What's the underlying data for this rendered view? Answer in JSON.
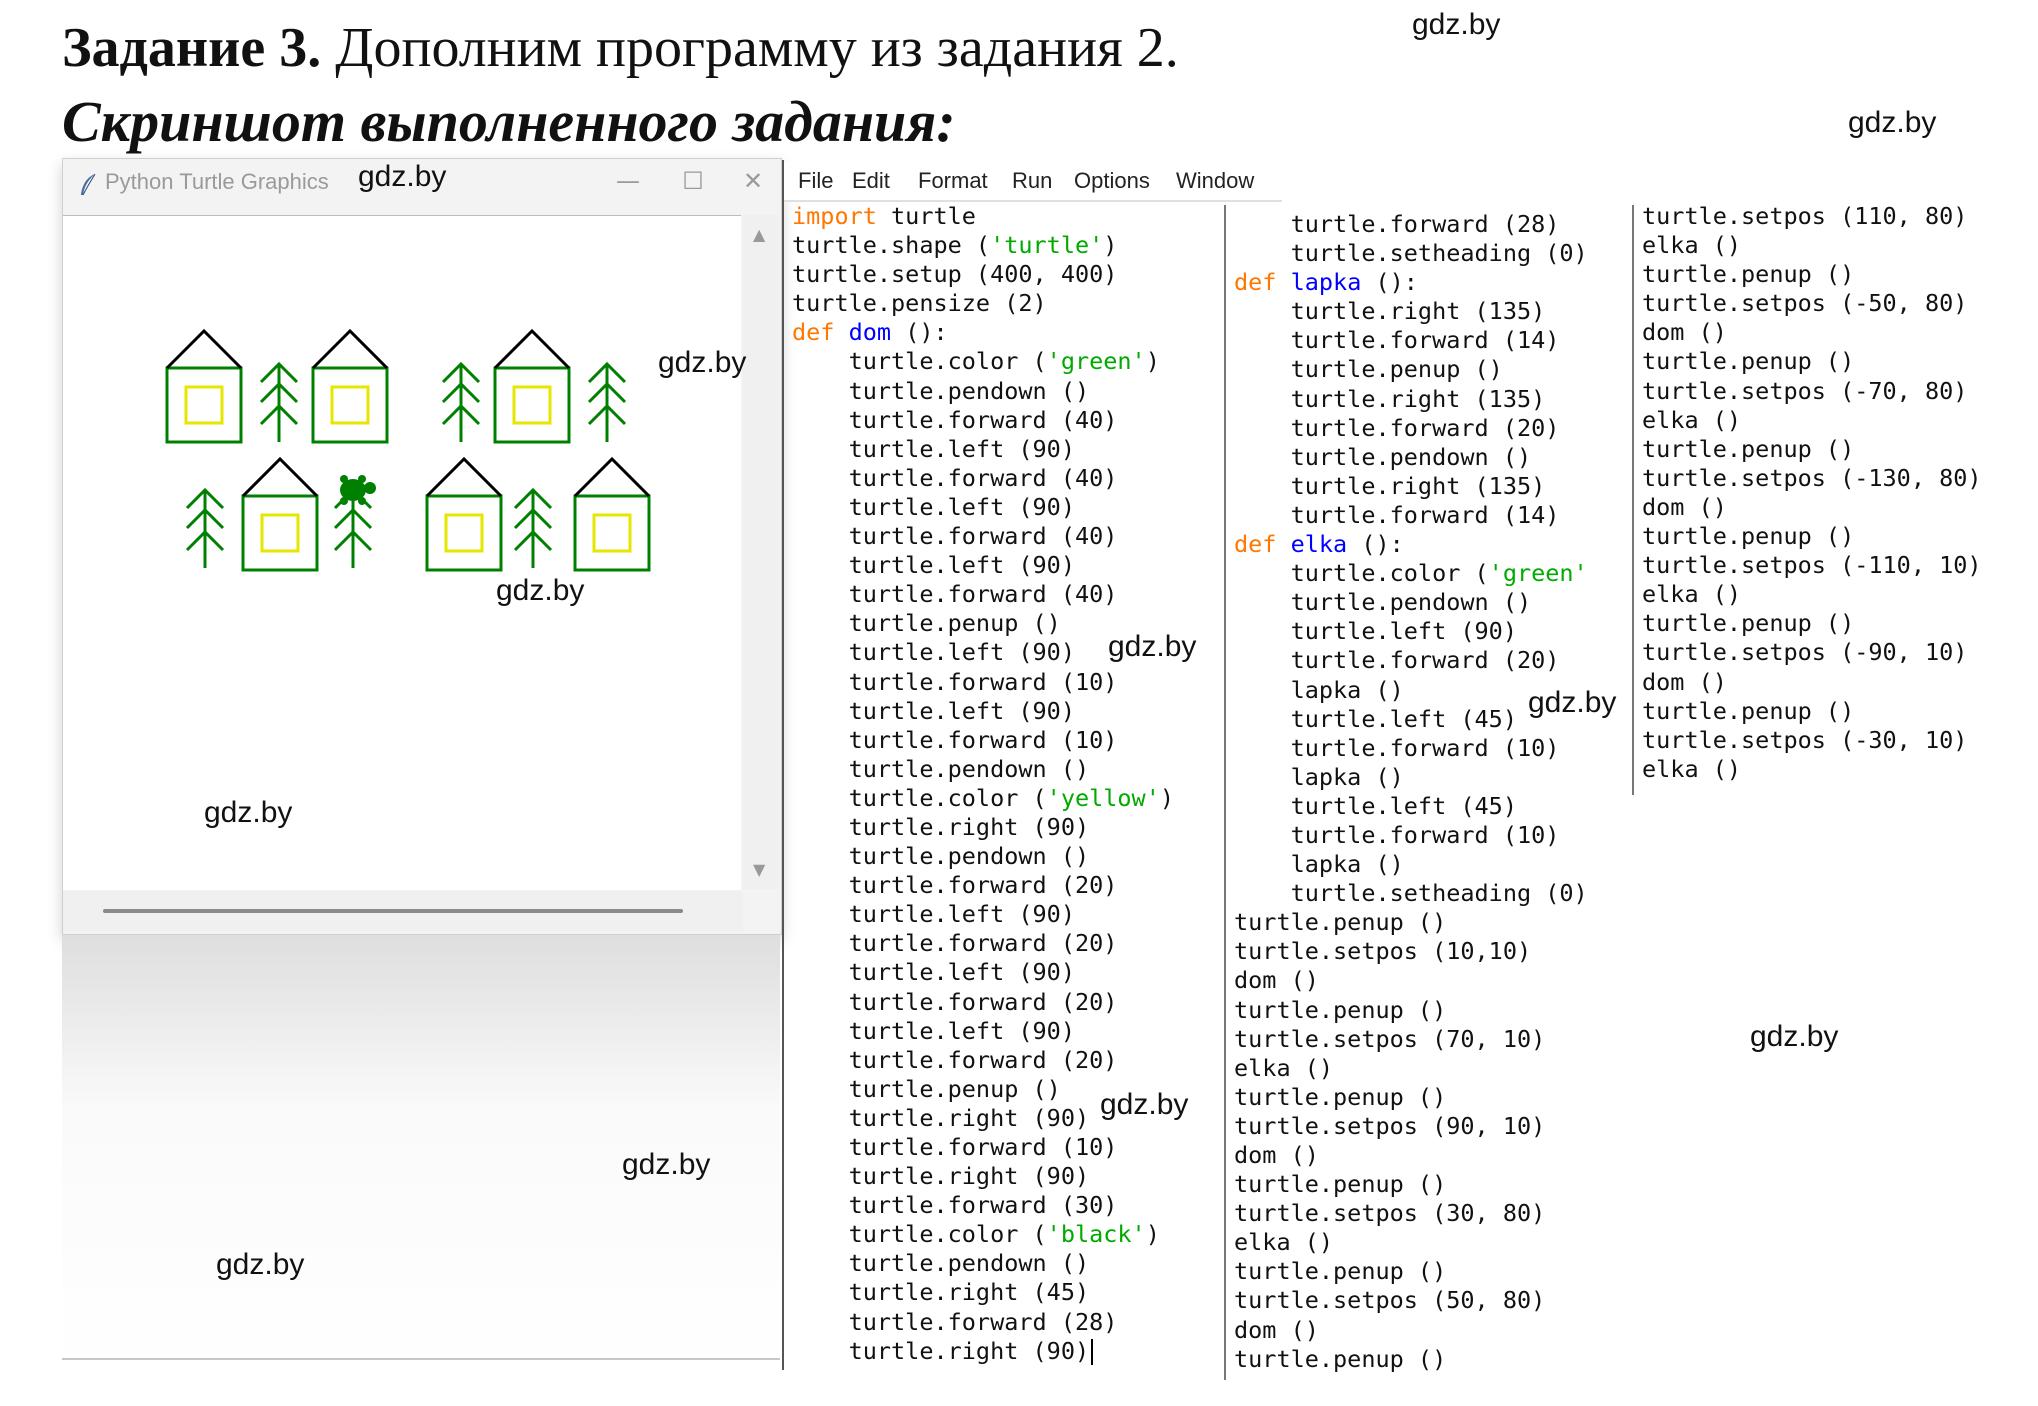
{
  "header": {
    "task_bold": "Задание 3.",
    "task_rest": " Дополним программу из задания 2.",
    "subtitle": "Скриншот выполненного задания:"
  },
  "watermark": "gdz.by",
  "turtle_window": {
    "title": "Python Turtle Graphics",
    "minimize_glyph": "—",
    "maximize_glyph": "☐",
    "close_glyph": "✕",
    "scroll_up": "▲",
    "scroll_down": "▼",
    "colors": {
      "house": "#008000",
      "window": "#e6e600",
      "roof": "#000000",
      "tree": "#008000"
    }
  },
  "editor": {
    "menu": [
      "File",
      "Edit",
      "Format",
      "Run",
      "Options",
      "Window"
    ],
    "columns": [
      [
        [
          {
            "t": "import",
            "c": "kw"
          },
          {
            "t": " turtle"
          }
        ],
        [
          {
            "t": "turtle.shape ("
          },
          {
            "t": "'turtle'",
            "c": "st"
          },
          {
            "t": ")"
          }
        ],
        [
          {
            "t": "turtle.setup (400, 400)"
          }
        ],
        [
          {
            "t": "turtle.pensize (2)"
          }
        ],
        [
          {
            "t": "def",
            "c": "kw"
          },
          {
            "t": " "
          },
          {
            "t": "dom",
            "c": "fn"
          },
          {
            "t": " ():"
          }
        ],
        [
          {
            "t": "    turtle.color ("
          },
          {
            "t": "'green'",
            "c": "st"
          },
          {
            "t": ")"
          }
        ],
        [
          {
            "t": "    turtle.pendown ()"
          }
        ],
        [
          {
            "t": "    turtle.forward (40)"
          }
        ],
        [
          {
            "t": "    turtle.left (90)"
          }
        ],
        [
          {
            "t": "    turtle.forward (40)"
          }
        ],
        [
          {
            "t": "    turtle.left (90)"
          }
        ],
        [
          {
            "t": "    turtle.forward (40)"
          }
        ],
        [
          {
            "t": "    turtle.left (90)"
          }
        ],
        [
          {
            "t": "    turtle.forward (40)"
          }
        ],
        [
          {
            "t": "    turtle.penup ()"
          }
        ],
        [
          {
            "t": "    turtle.left (90)"
          }
        ],
        [
          {
            "t": "    turtle.forward (10)"
          }
        ],
        [
          {
            "t": "    turtle.left (90)"
          }
        ],
        [
          {
            "t": "    turtle.forward (10)"
          }
        ],
        [
          {
            "t": "    turtle.pendown ()"
          }
        ],
        [
          {
            "t": "    turtle.color ("
          },
          {
            "t": "'yellow'",
            "c": "st"
          },
          {
            "t": ")"
          }
        ],
        [
          {
            "t": "    turtle.right (90)"
          }
        ],
        [
          {
            "t": "    turtle.pendown ()"
          }
        ],
        [
          {
            "t": "    turtle.forward (20)"
          }
        ],
        [
          {
            "t": "    turtle.left (90)"
          }
        ],
        [
          {
            "t": "    turtle.forward (20)"
          }
        ],
        [
          {
            "t": "    turtle.left (90)"
          }
        ],
        [
          {
            "t": "    turtle.forward (20)"
          }
        ],
        [
          {
            "t": "    turtle.left (90)"
          }
        ],
        [
          {
            "t": "    turtle.forward (20)"
          }
        ],
        [
          {
            "t": "    turtle.penup ()"
          }
        ],
        [
          {
            "t": "    turtle.right (90)"
          }
        ],
        [
          {
            "t": "    turtle.forward (10)"
          }
        ],
        [
          {
            "t": "    turtle.right (90)"
          }
        ],
        [
          {
            "t": "    turtle.forward (30)"
          }
        ],
        [
          {
            "t": "    turtle.color ("
          },
          {
            "t": "'black'",
            "c": "st"
          },
          {
            "t": ")"
          }
        ],
        [
          {
            "t": "    turtle.pendown ()"
          }
        ],
        [
          {
            "t": "    turtle.right (45)"
          }
        ],
        [
          {
            "t": "    turtle.forward (28)"
          }
        ],
        [
          {
            "t": "    turtle.right (90)"
          }
        ]
      ],
      [
        [
          {
            "t": "    turtle.forward (28)"
          }
        ],
        [
          {
            "t": "    turtle.setheading (0)"
          }
        ],
        [
          {
            "t": "def",
            "c": "kw"
          },
          {
            "t": " "
          },
          {
            "t": "lapka",
            "c": "fn"
          },
          {
            "t": " ():"
          }
        ],
        [
          {
            "t": "    turtle.right (135)"
          }
        ],
        [
          {
            "t": "    turtle.forward (14)"
          }
        ],
        [
          {
            "t": "    turtle.penup ()"
          }
        ],
        [
          {
            "t": "    turtle.right (135)"
          }
        ],
        [
          {
            "t": "    turtle.forward (20)"
          }
        ],
        [
          {
            "t": "    turtle.pendown ()"
          }
        ],
        [
          {
            "t": "    turtle.right (135)"
          }
        ],
        [
          {
            "t": "    turtle.forward (14)"
          }
        ],
        [
          {
            "t": "def",
            "c": "kw"
          },
          {
            "t": " "
          },
          {
            "t": "elka",
            "c": "fn"
          },
          {
            "t": " ():"
          }
        ],
        [
          {
            "t": "    turtle.color ("
          },
          {
            "t": "'green'",
            "c": "st"
          }
        ],
        [
          {
            "t": "    turtle.pendown ()"
          }
        ],
        [
          {
            "t": "    turtle.left (90)"
          }
        ],
        [
          {
            "t": "    turtle.forward (20)"
          }
        ],
        [
          {
            "t": "    lapka ()"
          }
        ],
        [
          {
            "t": "    turtle.left (45)"
          }
        ],
        [
          {
            "t": "    turtle.forward (10)"
          }
        ],
        [
          {
            "t": "    lapka ()"
          }
        ],
        [
          {
            "t": "    turtle.left (45)"
          }
        ],
        [
          {
            "t": "    turtle.forward (10)"
          }
        ],
        [
          {
            "t": "    lapka ()"
          }
        ],
        [
          {
            "t": "    turtle.setheading (0)"
          }
        ],
        [
          {
            "t": "turtle.penup ()"
          }
        ],
        [
          {
            "t": "turtle.setpos (10,10)"
          }
        ],
        [
          {
            "t": "dom ()"
          }
        ],
        [
          {
            "t": "turtle.penup ()"
          }
        ],
        [
          {
            "t": "turtle.setpos (70, 10)"
          }
        ],
        [
          {
            "t": "elka ()"
          }
        ],
        [
          {
            "t": "turtle.penup ()"
          }
        ],
        [
          {
            "t": "turtle.setpos (90, 10)"
          }
        ],
        [
          {
            "t": "dom ()"
          }
        ],
        [
          {
            "t": "turtle.penup ()"
          }
        ],
        [
          {
            "t": "turtle.setpos (30, 80)"
          }
        ],
        [
          {
            "t": "elka ()"
          }
        ],
        [
          {
            "t": "turtle.penup ()"
          }
        ],
        [
          {
            "t": "turtle.setpos (50, 80)"
          }
        ],
        [
          {
            "t": "dom ()"
          }
        ],
        [
          {
            "t": "turtle.penup ()"
          }
        ]
      ],
      [
        [
          {
            "t": "turtle.setpos (110, 80)"
          }
        ],
        [
          {
            "t": "elka ()"
          }
        ],
        [
          {
            "t": "turtle.penup ()"
          }
        ],
        [
          {
            "t": "turtle.setpos (-50, 80)"
          }
        ],
        [
          {
            "t": "dom ()"
          }
        ],
        [
          {
            "t": "turtle.penup ()"
          }
        ],
        [
          {
            "t": "turtle.setpos (-70, 80)"
          }
        ],
        [
          {
            "t": "elka ()"
          }
        ],
        [
          {
            "t": "turtle.penup ()"
          }
        ],
        [
          {
            "t": "turtle.setpos (-130, 80)"
          }
        ],
        [
          {
            "t": "dom ()"
          }
        ],
        [
          {
            "t": "turtle.penup ()"
          }
        ],
        [
          {
            "t": "turtle.setpos (-110, 10)"
          }
        ],
        [
          {
            "t": "elka ()"
          }
        ],
        [
          {
            "t": "turtle.penup ()"
          }
        ],
        [
          {
            "t": "turtle.setpos (-90, 10)"
          }
        ],
        [
          {
            "t": "dom ()"
          }
        ],
        [
          {
            "t": "turtle.penup ()"
          }
        ],
        [
          {
            "t": "turtle.setpos (-30, 10)"
          }
        ],
        [
          {
            "t": "elka ()"
          }
        ]
      ]
    ]
  }
}
